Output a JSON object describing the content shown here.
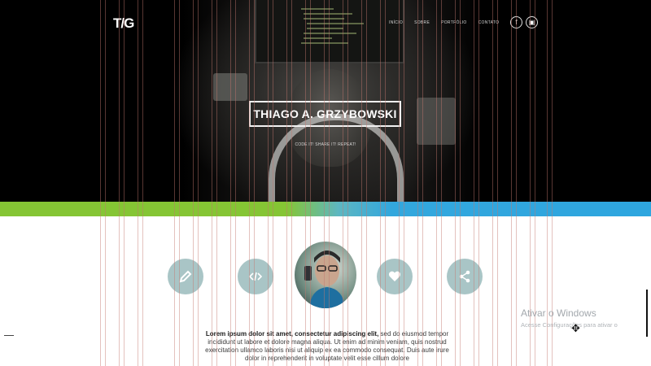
{
  "header": {
    "logo": "T/G",
    "nav": [
      "INÍCIO",
      "SOBRE",
      "PORTFÓLIO",
      "CONTATO"
    ],
    "social": [
      {
        "name": "facebook",
        "glyph": "f"
      },
      {
        "name": "other",
        "glyph": "▣"
      }
    ]
  },
  "hero": {
    "title": "THIAGO A. GRZYBOWSKI",
    "tagline": "CODE IT! SHARE IT! REPEAT!"
  },
  "features": {
    "icons": [
      "pencil-icon",
      "code-icon",
      "heart-icon",
      "share-icon"
    ]
  },
  "intro": {
    "bold": "Lorem ipsum dolor sit amet, consectetur adipiscing elit,",
    "rest": " sed do eiusmod tempor incididunt ut labore et dolore magna aliqua. Ut enim ad minim veniam, quis nostrud exercitation ullamco laboris nisi ut aliquip ex ea commodo consequat. Duis aute irure dolor in reprehenderit in voluptate velit esse cillum dolore"
  },
  "watermark": {
    "title": "Ativar o Windows",
    "subtitle": "Acesse Configurações para ativar o"
  },
  "colors": {
    "green": "#85c534",
    "blue": "#2ea6df",
    "icon_circle": "#a9c5c6"
  }
}
